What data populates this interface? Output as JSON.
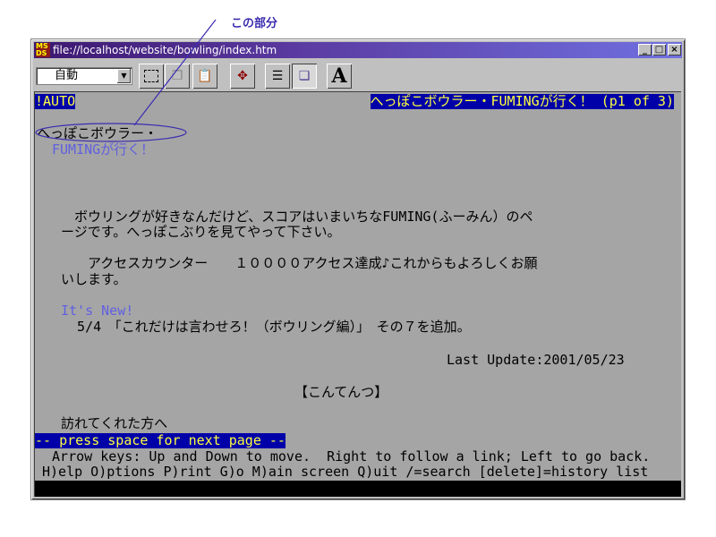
{
  "annotation": {
    "label": "この部分"
  },
  "window": {
    "title": "file://localhost/website/bowling/index.htm",
    "controls": {
      "minimize": "_",
      "maximize": "□",
      "close": "×"
    }
  },
  "toolbar": {
    "encoding": "自動",
    "buttons": [
      "select-icon",
      "copy-icon",
      "paste-icon",
      "move-icon",
      "properties-icon",
      "window-icon",
      "font-icon"
    ],
    "font_label": "A"
  },
  "terminal": {
    "status_left": "!AUTO",
    "status_right": "へっぽこボウラー・FUMINGが行く！ (p1 of 3)",
    "heading1": "へっぽこボウラー・",
    "heading2": "FUMINGが行く！",
    "para1_l1": "　ボウリングが好きなんだけど、スコアはいまいちなFUMING(ふーみん）のペ",
    "para1_l2": "ージです。へっぽこぶりを見てやって下さい。",
    "para2_l1": "　　アクセスカウンター　　１００００アクセス達成♪これからもよろしくお願",
    "para2_l2": "いします。",
    "its_new": "It's New!",
    "news": "  5/4　「これだけは言わせろ！（ボウリング編）」　その７を追加。",
    "last_update": "Last Update:2001/05/23",
    "contents": "【こんてんつ】",
    "visitors": "訪れてくれた方へ",
    "press_space": "-- press space for next page --",
    "help1": " Arrow keys: Up and Down to move.  Right to follow a link; Left to go back.",
    "help2": "H)elp O)ptions P)rint G)o M)ain screen Q)uit /=search [delete]=history list"
  },
  "colors": {
    "highlight_bg": "#0000a8",
    "highlight_fg": "#ffff40",
    "link": "#6060e0",
    "terminal_bg": "#a5a5a5"
  }
}
